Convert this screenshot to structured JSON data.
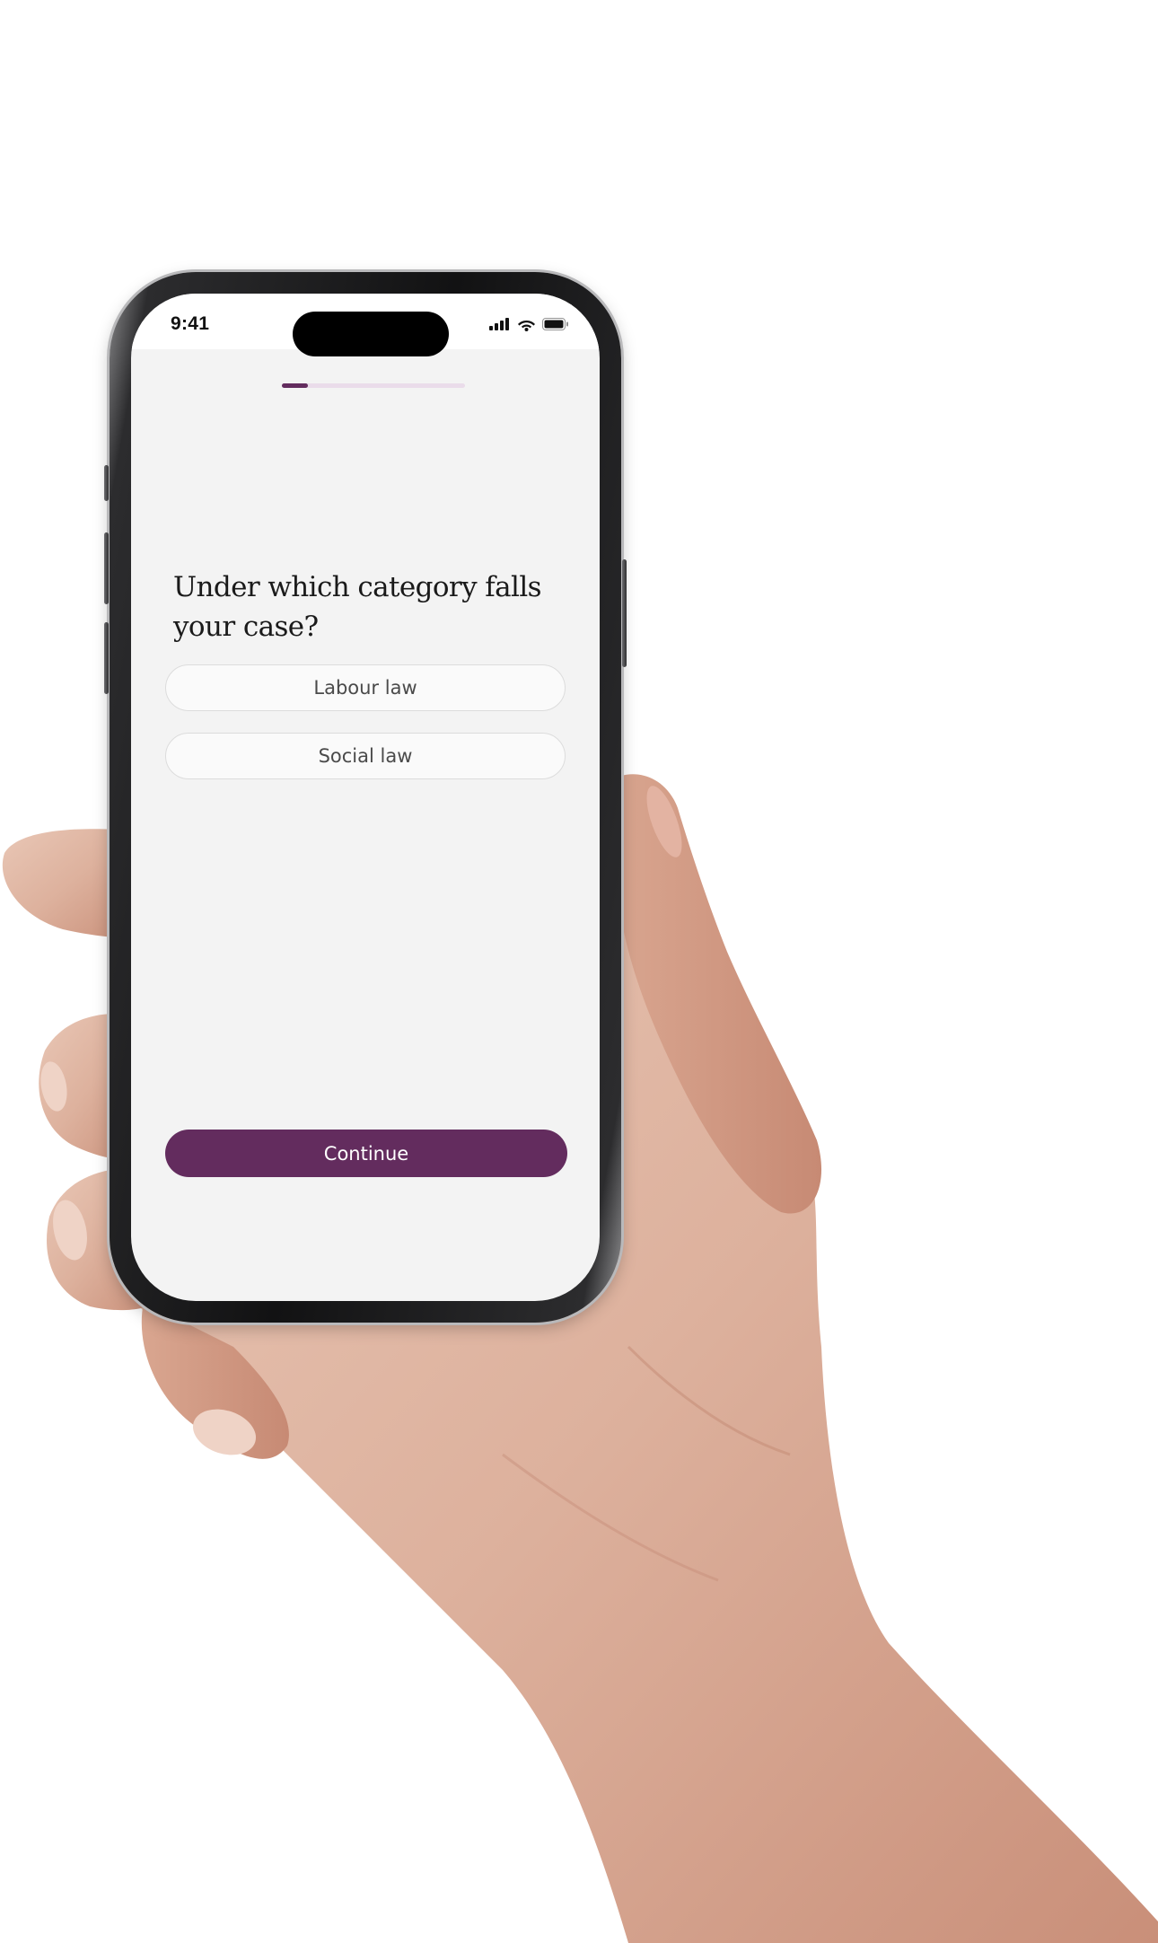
{
  "status_bar": {
    "time": "9:41",
    "icons": [
      "cellular-signal-icon",
      "wifi-icon",
      "battery-icon"
    ]
  },
  "progress": {
    "fraction": 0.14
  },
  "question": {
    "title": "Under which category falls your case?"
  },
  "options": [
    {
      "label": "Labour law"
    },
    {
      "label": "Social law"
    }
  ],
  "actions": {
    "continue_label": "Continue"
  },
  "colors": {
    "accent": "#632c5e",
    "progress_track": "#eadcea",
    "screen_background": "#f3f3f3"
  }
}
